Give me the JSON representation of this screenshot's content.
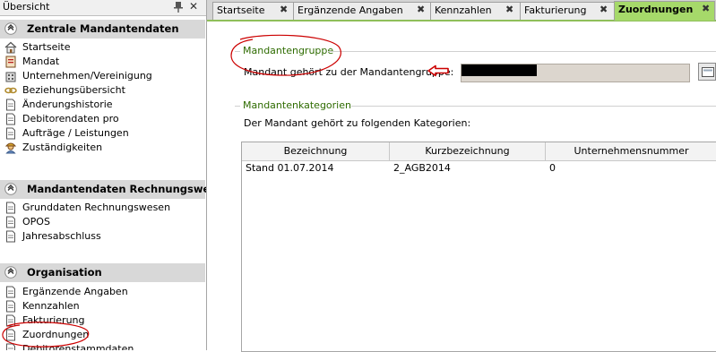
{
  "sidebar": {
    "title": "Übersicht",
    "sections": [
      {
        "title": "Zentrale Mandantendaten",
        "items": [
          "Startseite",
          "Mandat",
          "Unternehmen/Vereinigung",
          "Beziehungsübersicht",
          "Änderungshistorie",
          "Debitorendaten pro",
          "Aufträge / Leistungen",
          "Zuständigkeiten"
        ]
      },
      {
        "title": "Mandantendaten Rechnungswe...",
        "items": [
          "Grunddaten Rechnungswesen",
          "OPOS",
          "Jahresabschluss"
        ]
      },
      {
        "title": "Organisation",
        "items": [
          "Ergänzende Angaben",
          "Kennzahlen",
          "Fakturierung",
          "Zuordnungen",
          "Debitorenstammdaten"
        ]
      }
    ]
  },
  "tabs": [
    {
      "label": "Startseite",
      "active": false
    },
    {
      "label": "Ergänzende Angaben",
      "active": false
    },
    {
      "label": "Kennzahlen",
      "active": false
    },
    {
      "label": "Fakturierung",
      "active": false
    },
    {
      "label": "Zuordnungen",
      "active": true
    }
  ],
  "tab_close_glyph": "✖",
  "main": {
    "group1": {
      "title": "Mandantengruppe",
      "label": "Mandant gehört zu der Mandantengruppe:",
      "value": ""
    },
    "group2": {
      "title": "Mandantenkategorien",
      "label": "Der Mandant gehört zu folgenden Kategorien:"
    },
    "table": {
      "columns": [
        "Bezeichnung",
        "Kurzbezeichnung",
        "Unternehmensnummer"
      ],
      "rows": [
        [
          "Stand 01.07.2014",
          "2_AGB2014",
          "0"
        ]
      ]
    }
  },
  "colors": {
    "active_tab": "#a6d96a",
    "group_title": "#2e6b00",
    "annotation": "#cc0000"
  }
}
